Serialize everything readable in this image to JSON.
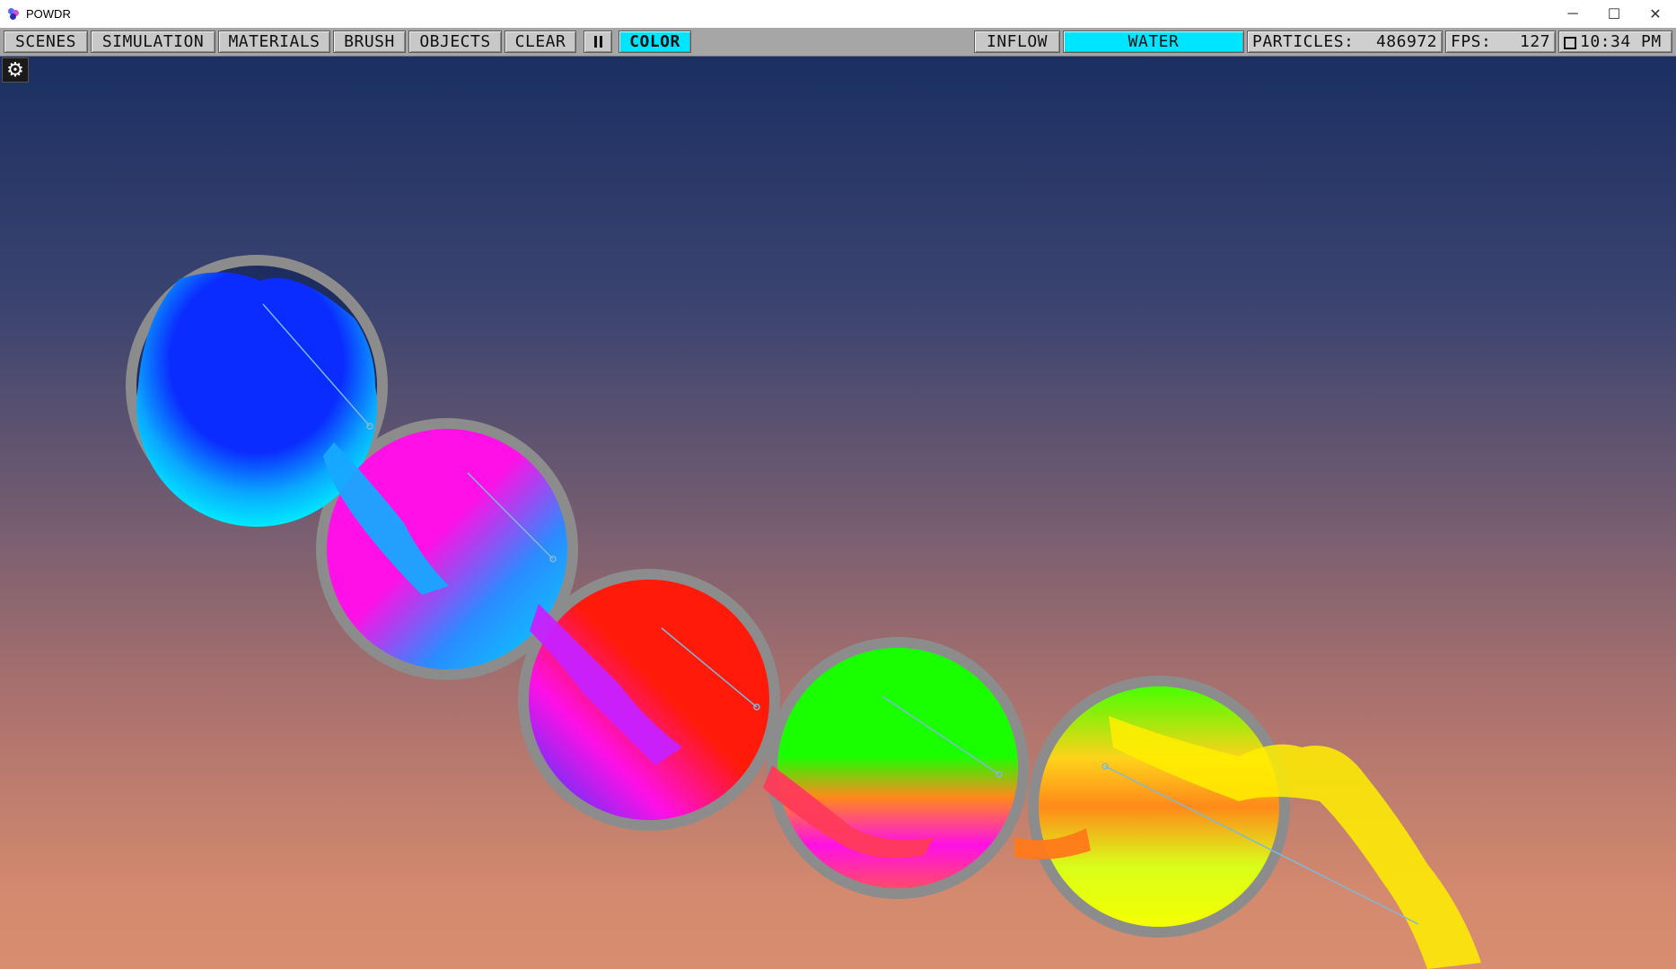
{
  "window": {
    "title": "POWDR",
    "minimize_glyph": "─",
    "maximize_glyph": "☐",
    "close_glyph": "✕"
  },
  "toolbar": {
    "scenes": "SCENES",
    "simulation": "SIMULATION",
    "materials": "MATERIALS",
    "brush": "BRUSH",
    "objects": "OBJECTS",
    "clear": "CLEAR",
    "color": "COLOR",
    "inflow": "INFLOW",
    "material": "WATER",
    "particles_label": "PARTICLES:",
    "particles_value": "486972",
    "fps_label": "FPS:",
    "fps_value": "127",
    "time": "10:34 PM"
  },
  "settings": {
    "icon": "gear-icon",
    "glyph": "⚙"
  },
  "colors": {
    "accent": "#00e5ff",
    "container_ring": "#8c8c8c",
    "sphere_1": "#0a2cff",
    "sphere_2": "#ff10e6",
    "sphere_3": "#ff1a0a",
    "sphere_4": "#19ff00",
    "sphere_5": "#f5ff00"
  }
}
